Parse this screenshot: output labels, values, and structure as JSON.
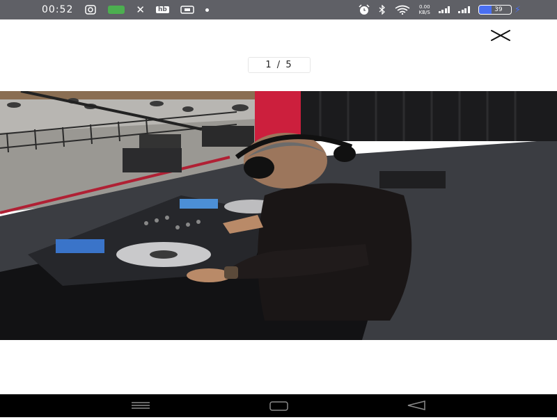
{
  "status_bar": {
    "time": "00:52",
    "left_icons": [
      "instagram-icon",
      "message-icon",
      "x-icon",
      "hb-icon",
      "box-icon",
      "dot-icon"
    ],
    "hb_label": "hb",
    "right_icons": [
      "alarm-icon",
      "bluetooth-icon",
      "wifi-icon",
      "data-speed-icon",
      "signal-icon",
      "signal-icon",
      "battery-icon",
      "charging-icon"
    ],
    "net_speed_value": "0.00",
    "net_speed_unit": "KB/S",
    "battery_level": "39",
    "battery_color": "#4a6ff0"
  },
  "viewer": {
    "close_icon": "close-icon",
    "counter": "1 / 5",
    "image_semantic": "dj-mixing-at-outdoor-stage"
  },
  "nav_bar": {
    "buttons": [
      "menu-icon",
      "home-icon",
      "back-icon"
    ]
  }
}
